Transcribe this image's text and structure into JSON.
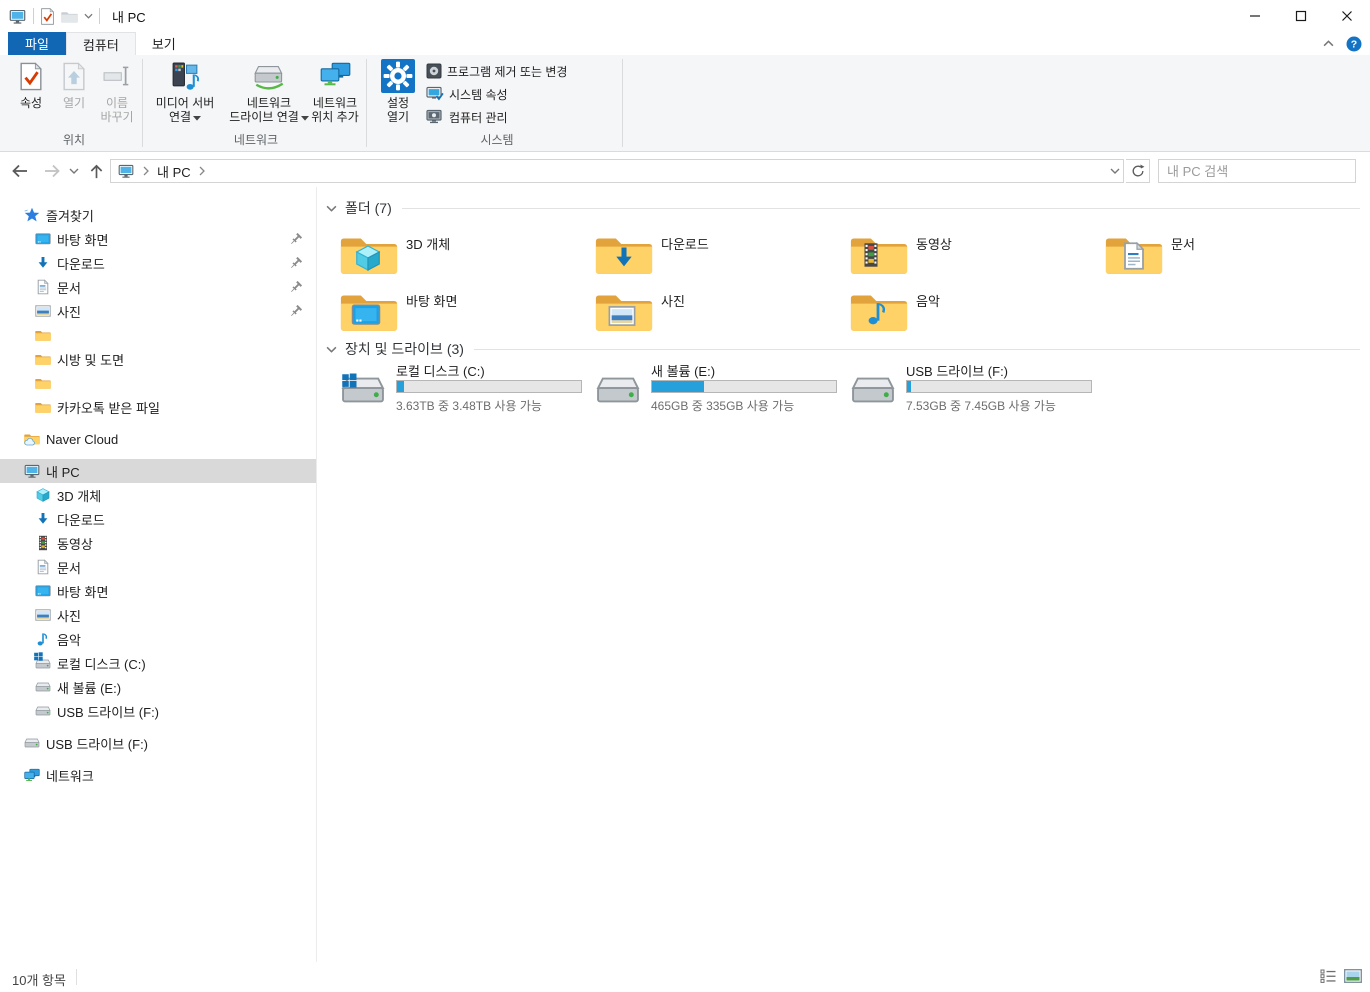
{
  "window": {
    "title": "내 PC"
  },
  "tabs": {
    "file": "파일",
    "computer": "컴퓨터",
    "view": "보기"
  },
  "ribbon": {
    "location": {
      "label": "위치",
      "properties": "속성",
      "open": "열기",
      "rename1": "이름",
      "rename2": "바꾸기"
    },
    "network": {
      "label": "네트워크",
      "media1": "미디어 서버",
      "media2": "연결",
      "map1": "네트워크",
      "map2": "드라이브 연결",
      "add1": "네트워크",
      "add2": "위치 추가"
    },
    "system": {
      "label": "시스템",
      "settings1": "설정",
      "settings2": "열기",
      "uninstall": "프로그램 제거 또는 변경",
      "sysprops": "시스템 속성",
      "management": "컴퓨터 관리"
    }
  },
  "nav": {
    "breadcrumb_root": "내 PC",
    "search_placeholder": "내 PC 검색"
  },
  "sidebar": {
    "quick_access": {
      "label": "즐겨찾기",
      "items": [
        {
          "label": "바탕 화면"
        },
        {
          "label": "다운로드"
        },
        {
          "label": "문서"
        },
        {
          "label": "사진"
        },
        {
          "label": ""
        },
        {
          "label": "시방 및 도면"
        },
        {
          "label": ""
        },
        {
          "label": "카카오톡 받은 파일"
        }
      ]
    },
    "naver": {
      "label": "Naver Cloud"
    },
    "this_pc": {
      "label": "내 PC",
      "items": [
        {
          "label": "3D 개체"
        },
        {
          "label": "다운로드"
        },
        {
          "label": "동영상"
        },
        {
          "label": "문서"
        },
        {
          "label": "바탕 화면"
        },
        {
          "label": "사진"
        },
        {
          "label": "음악"
        },
        {
          "label": "로컬 디스크 (C:)"
        },
        {
          "label": "새 볼륨 (E:)"
        },
        {
          "label": "USB 드라이브 (F:)"
        }
      ]
    },
    "usb": {
      "label": "USB 드라이브 (F:)"
    },
    "network": {
      "label": "네트워크"
    }
  },
  "main": {
    "folders": {
      "label": "폴더 (7)",
      "items": [
        {
          "name": "3D 개체"
        },
        {
          "name": "다운로드"
        },
        {
          "name": "동영상"
        },
        {
          "name": "문서"
        },
        {
          "name": "바탕 화면"
        },
        {
          "name": "사진"
        },
        {
          "name": "음악"
        }
      ]
    },
    "drives": {
      "label": "장치 및 드라이브 (3)",
      "items": [
        {
          "name": "로컬 디스크 (C:)",
          "free": "3.63TB 중 3.48TB 사용 가능",
          "used_pct": 4
        },
        {
          "name": "새 볼륨 (E:)",
          "free": "465GB 중 335GB 사용 가능",
          "used_pct": 28
        },
        {
          "name": "USB 드라이브 (F:)",
          "free": "7.53GB 중 7.45GB 사용 가능",
          "used_pct": 2
        }
      ]
    }
  },
  "statusbar": {
    "count": "10개 항목"
  },
  "colors": {
    "accent_blue": "#1267b5",
    "progress_blue": "#26a0da",
    "folder_yellow": "#ffd267"
  }
}
